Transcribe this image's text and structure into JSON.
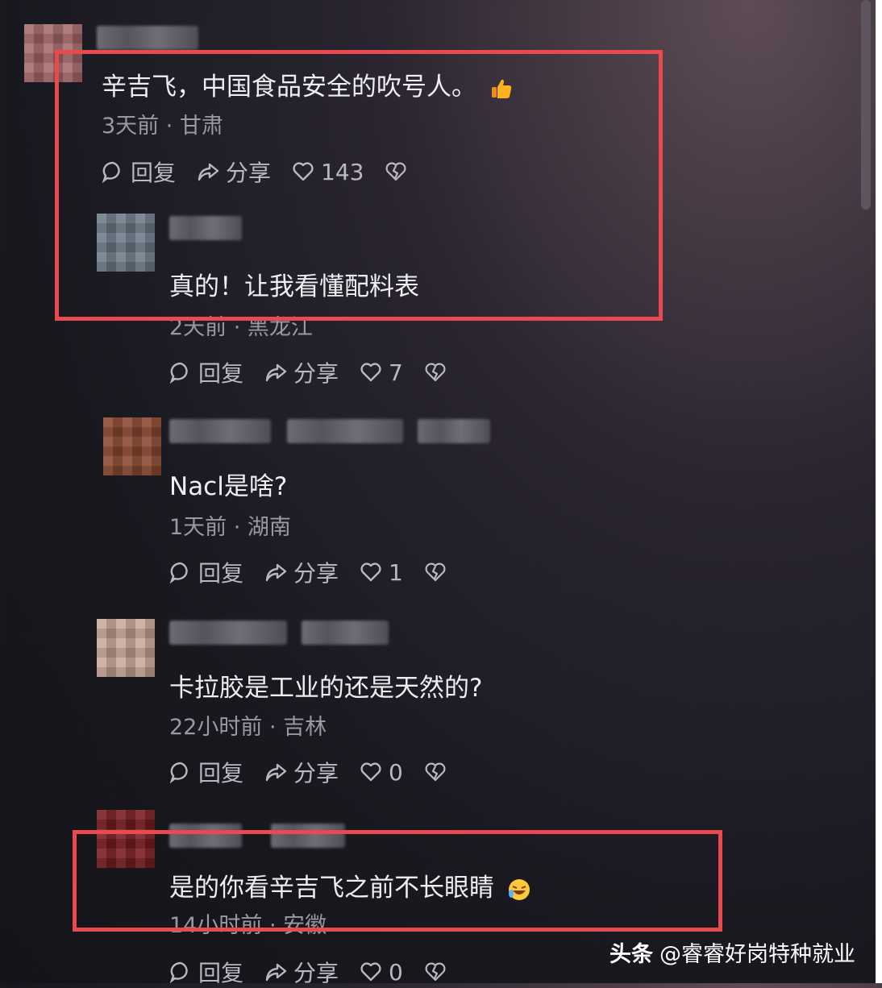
{
  "comments": [
    {
      "text": "辛吉飞，中国食品安全的吹号人。",
      "meta": "3天前 · 甘肃",
      "reply_label": "回复",
      "share_label": "分享",
      "likes": "143"
    },
    {
      "text": "真的！让我看懂配料表",
      "meta": "2天前 · 黑龙江",
      "reply_label": "回复",
      "share_label": "分享",
      "likes": "7"
    },
    {
      "text": "Nacl是啥?",
      "meta": "1天前 · 湖南",
      "reply_label": "回复",
      "share_label": "分享",
      "likes": "1"
    },
    {
      "text": "卡拉胶是工业的还是天然的?",
      "meta": "22小时前 · 吉林",
      "reply_label": "回复",
      "share_label": "分享",
      "likes": "0"
    },
    {
      "text": "是的你看辛吉飞之前不长眼睛",
      "meta": "14小时前 · 安徽",
      "reply_label": "回复",
      "share_label": "分享",
      "likes": "0"
    }
  ],
  "watermark": {
    "brand": "头条",
    "account": "@睿睿好岗特种就业"
  },
  "colors": {
    "highlight": "#e84a4f",
    "background": "#18181f"
  },
  "icons": [
    "comment-icon",
    "share-icon",
    "heart-icon",
    "broken-heart-icon",
    "thumbs-up-emoji",
    "laughing-emoji"
  ]
}
